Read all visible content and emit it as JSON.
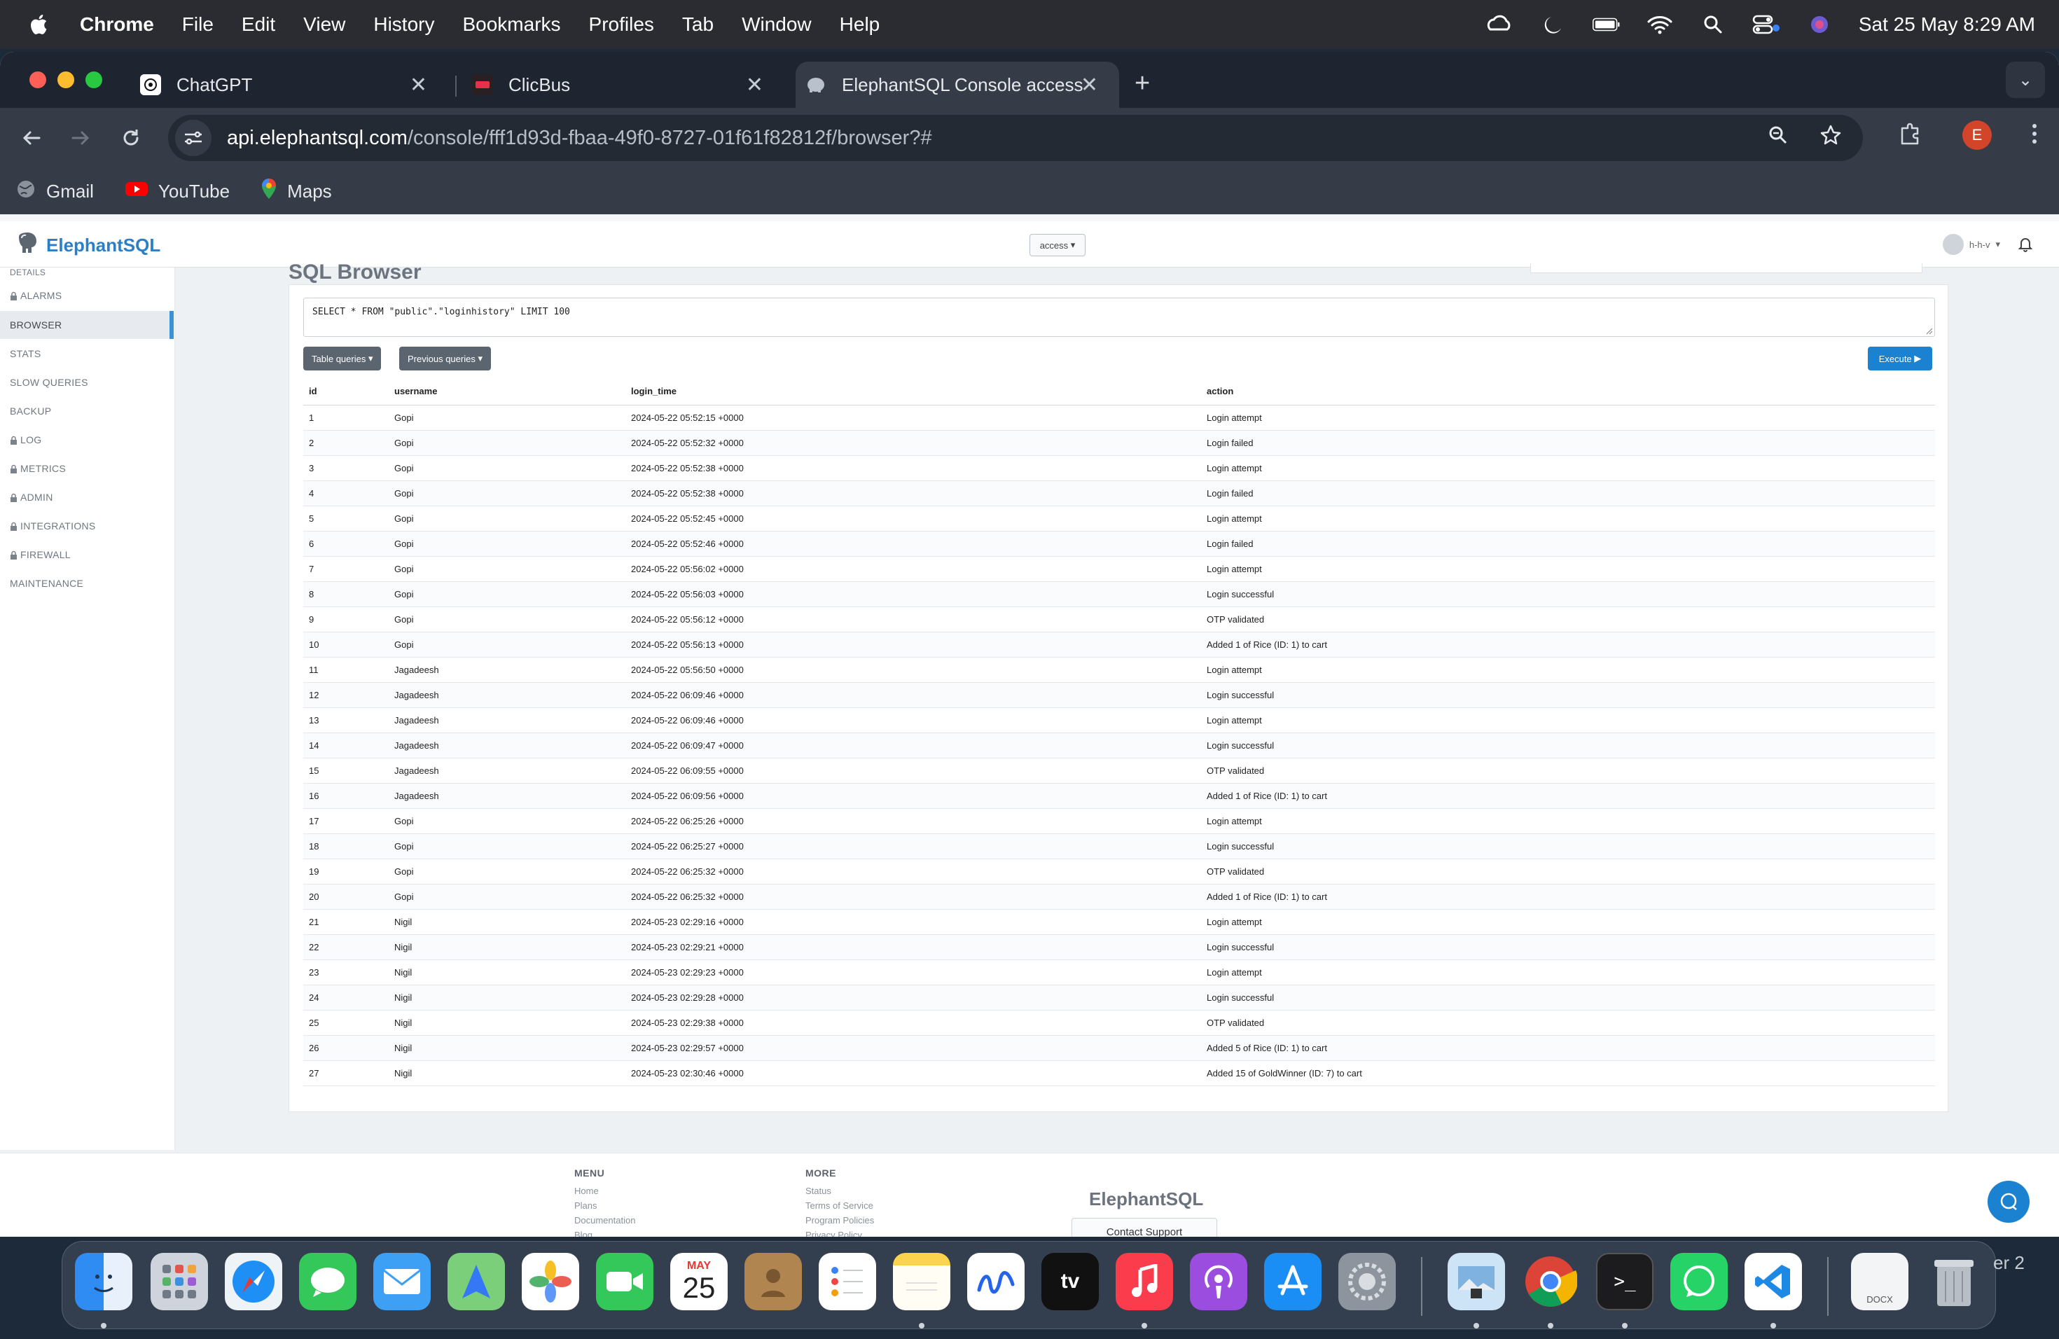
{
  "menubar": {
    "app": "Chrome",
    "items": [
      "File",
      "Edit",
      "View",
      "History",
      "Bookmarks",
      "Profiles",
      "Tab",
      "Window",
      "Help"
    ],
    "clock": "Sat 25 May  8:29 AM"
  },
  "tabs": [
    {
      "title": "ChatGPT",
      "icon": "chatgpt-icon"
    },
    {
      "title": "ClicBus",
      "icon": "clicbus-icon"
    },
    {
      "title": "ElephantSQL Console access",
      "icon": "elephant-icon",
      "active": true
    }
  ],
  "address": {
    "host": "api.elephantsql.com",
    "path": "/console/fff1d93d-fbaa-49f0-8727-01f61f82812f/browser?#"
  },
  "bookmarks": [
    "Gmail",
    "YouTube",
    "Maps"
  ],
  "profile_initial": "E",
  "app": {
    "brand": "ElephantSQL",
    "access_label": "access",
    "user_label": "h-h-v"
  },
  "sidebar": {
    "items": [
      {
        "label": "ALARMS",
        "locked": true
      },
      {
        "label": "BROWSER",
        "locked": false,
        "active": true
      },
      {
        "label": "STATS",
        "locked": false
      },
      {
        "label": "SLOW QUERIES",
        "locked": false
      },
      {
        "label": "BACKUP",
        "locked": false
      },
      {
        "label": "LOG",
        "locked": true
      },
      {
        "label": "METRICS",
        "locked": true
      },
      {
        "label": "ADMIN",
        "locked": true
      },
      {
        "label": "INTEGRATIONS",
        "locked": true
      },
      {
        "label": "FIREWALL",
        "locked": true
      },
      {
        "label": "MAINTENANCE",
        "locked": false
      }
    ]
  },
  "browser": {
    "title": "SQL Browser",
    "query": "SELECT * FROM \"public\".\"loginhistory\" LIMIT 100",
    "table_queries_label": "Table queries",
    "previous_queries_label": "Previous queries",
    "execute_label": "Execute",
    "columns": [
      "id",
      "username",
      "login_time",
      "action"
    ],
    "rows": [
      [
        "1",
        "Gopi",
        "2024-05-22 05:52:15 +0000",
        "Login attempt"
      ],
      [
        "2",
        "Gopi",
        "2024-05-22 05:52:32 +0000",
        "Login failed"
      ],
      [
        "3",
        "Gopi",
        "2024-05-22 05:52:38 +0000",
        "Login attempt"
      ],
      [
        "4",
        "Gopi",
        "2024-05-22 05:52:38 +0000",
        "Login failed"
      ],
      [
        "5",
        "Gopi",
        "2024-05-22 05:52:45 +0000",
        "Login attempt"
      ],
      [
        "6",
        "Gopi",
        "2024-05-22 05:52:46 +0000",
        "Login failed"
      ],
      [
        "7",
        "Gopi",
        "2024-05-22 05:56:02 +0000",
        "Login attempt"
      ],
      [
        "8",
        "Gopi",
        "2024-05-22 05:56:03 +0000",
        "Login successful"
      ],
      [
        "9",
        "Gopi",
        "2024-05-22 05:56:12 +0000",
        "OTP validated"
      ],
      [
        "10",
        "Gopi",
        "2024-05-22 05:56:13 +0000",
        "Added 1 of Rice (ID: 1) to cart"
      ],
      [
        "11",
        "Jagadeesh",
        "2024-05-22 05:56:50 +0000",
        "Login attempt"
      ],
      [
        "12",
        "Jagadeesh",
        "2024-05-22 06:09:46 +0000",
        "Login successful"
      ],
      [
        "13",
        "Jagadeesh",
        "2024-05-22 06:09:46 +0000",
        "Login attempt"
      ],
      [
        "14",
        "Jagadeesh",
        "2024-05-22 06:09:47 +0000",
        "Login successful"
      ],
      [
        "15",
        "Jagadeesh",
        "2024-05-22 06:09:55 +0000",
        "OTP validated"
      ],
      [
        "16",
        "Jagadeesh",
        "2024-05-22 06:09:56 +0000",
        "Added 1 of Rice (ID: 1) to cart"
      ],
      [
        "17",
        "Gopi",
        "2024-05-22 06:25:26 +0000",
        "Login attempt"
      ],
      [
        "18",
        "Gopi",
        "2024-05-22 06:25:27 +0000",
        "Login successful"
      ],
      [
        "19",
        "Gopi",
        "2024-05-22 06:25:32 +0000",
        "OTP validated"
      ],
      [
        "20",
        "Gopi",
        "2024-05-22 06:25:32 +0000",
        "Added 1 of Rice (ID: 1) to cart"
      ],
      [
        "21",
        "Nigil",
        "2024-05-23 02:29:16 +0000",
        "Login attempt"
      ],
      [
        "22",
        "Nigil",
        "2024-05-23 02:29:21 +0000",
        "Login successful"
      ],
      [
        "23",
        "Nigil",
        "2024-05-23 02:29:23 +0000",
        "Login attempt"
      ],
      [
        "24",
        "Nigil",
        "2024-05-23 02:29:28 +0000",
        "Login successful"
      ],
      [
        "25",
        "Nigil",
        "2024-05-23 02:29:38 +0000",
        "OTP validated"
      ],
      [
        "26",
        "Nigil",
        "2024-05-23 02:29:57 +0000",
        "Added 5 of Rice (ID: 1) to cart"
      ],
      [
        "27",
        "Nigil",
        "2024-05-23 02:30:46 +0000",
        "Added 15 of GoldWinner (ID: 7) to cart"
      ]
    ]
  },
  "footer": {
    "menu_heading": "MENU",
    "menu_links": [
      "Home",
      "Plans",
      "Documentation",
      "Blog"
    ],
    "more_heading": "MORE",
    "more_links": [
      "Status",
      "Terms of Service",
      "Program Policies",
      "Privacy Policy"
    ],
    "brand": "ElephantSQL",
    "support_label": "Contact Support"
  },
  "dock": {
    "calendar_month": "MAY",
    "calendar_day": "25",
    "doc_label": "DOCX",
    "desktop_label": "er 2",
    "apps": [
      "finder",
      "launchpad",
      "safari",
      "messages",
      "mail",
      "maps",
      "photos",
      "facetime",
      "calendar",
      "contacts",
      "reminders",
      "notes",
      "freeform",
      "tv",
      "music",
      "podcasts",
      "app-store",
      "system-settings",
      "preview",
      "chrome",
      "terminal",
      "whatsapp",
      "vscode",
      "document",
      "trash"
    ]
  },
  "colors": {
    "accent": "#1a82d1",
    "sidebar_active": "#3a93d6",
    "brand": "#2b7fc6",
    "chrome_tab": "#353c48"
  }
}
